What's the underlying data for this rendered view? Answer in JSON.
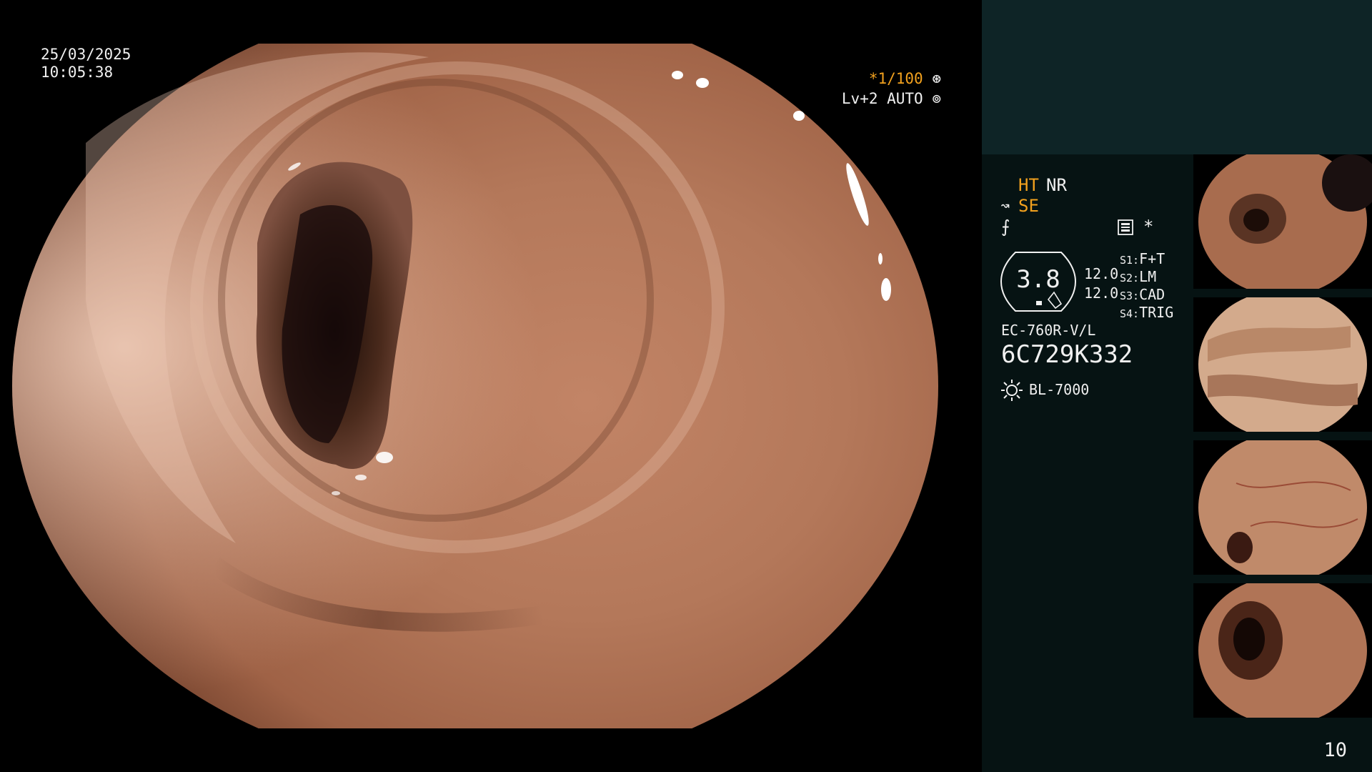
{
  "overlay": {
    "date": "25/03/2025",
    "time": "10:05:38",
    "shutter_prefix": "*",
    "shutter": "1/100",
    "shutter_icon": "aperture-icon",
    "light_level": "Lv+2 AUTO",
    "light_icon": "auto-light-icon"
  },
  "settings": {
    "ht": "HT",
    "nr": "NR",
    "se": "SE",
    "se_icon": "structure-enhance-icon",
    "ae_icon": "exposure-icon",
    "rec_icon": "record-icon",
    "star": "*",
    "zoom": "3.8",
    "val1": "12.0",
    "val2": "12.0",
    "switches": [
      {
        "key": "S1:",
        "value": "F+T"
      },
      {
        "key": "S2:",
        "value": "LM"
      },
      {
        "key": "S3:",
        "value": "CAD"
      },
      {
        "key": "S4:",
        "value": "TRIG"
      }
    ],
    "scope_model": "EC-760R-V/L",
    "scope_serial": "6C729K332",
    "light_source": "BL-7000",
    "light_source_icon": "lamp-icon"
  },
  "page_number": "10",
  "colors": {
    "accent_orange": "#f2a11e",
    "panel_top": "#0e2426",
    "panel_bottom": "#061313",
    "tissue": "#b57a5a"
  }
}
